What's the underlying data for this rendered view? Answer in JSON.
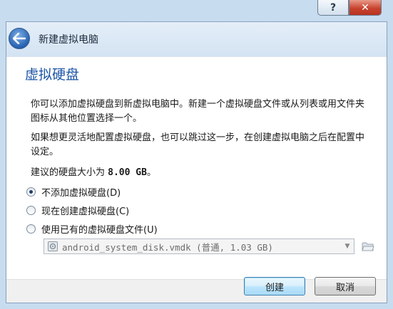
{
  "window": {
    "help_glyph": "?",
    "close_glyph": "✕"
  },
  "header": {
    "title": "新建虚拟电脑"
  },
  "page": {
    "section_title": "虚拟硬盘",
    "paragraph1": "你可以添加虚拟硬盘到新虚拟电脑中。新建一个虚拟硬盘文件或从列表或用文件夹图标从其他位置选择一个。",
    "paragraph2": "如果想更灵活地配置虚拟硬盘，也可以跳过这一步，在创建虚拟电脑之后在配置中设定。",
    "size_prefix": "建议的硬盘大小为 ",
    "size_value": "8.00 GB",
    "size_suffix": "。"
  },
  "options": [
    {
      "label": "不添加虚拟硬盘(D)",
      "selected": true
    },
    {
      "label": "现在创建虚拟硬盘(C)",
      "selected": false
    },
    {
      "label": "使用已有的虚拟硬盘文件(U)",
      "selected": false
    }
  ],
  "disk_combo": {
    "value": "android_system_disk.vmdk (普通, 1.03 GB)",
    "enabled": false
  },
  "buttons": {
    "create": "创建",
    "cancel": "取消"
  },
  "colors": {
    "title_blue": "#1d55a6",
    "window_frame": "#c7dcee",
    "close_red": "#c8442f"
  }
}
